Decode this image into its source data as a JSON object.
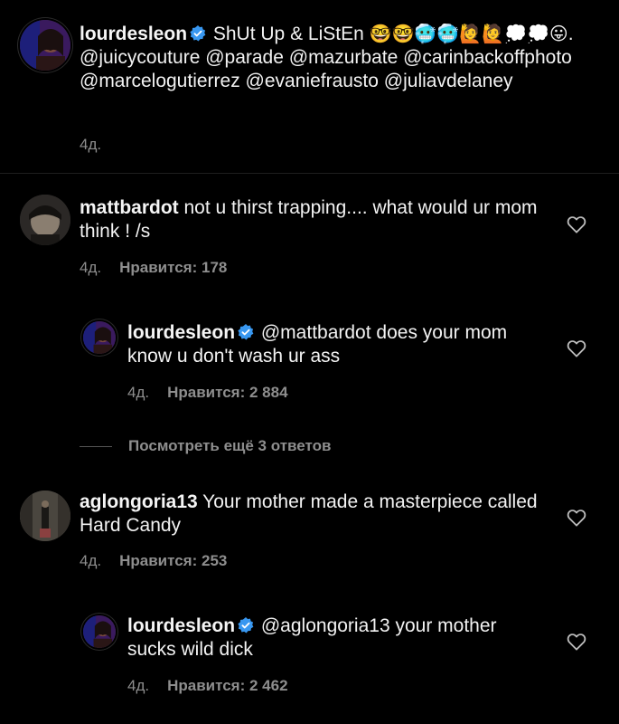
{
  "caption": {
    "username": "lourdesleon",
    "text_before_tags": " ShUt Up & LiStEn ",
    "emojis": "🤓🤓🥶🥶🙋🙋💭💭😛",
    "tags": ". @juicycouture @parade @mazurbate @carinbackoffphoto @marcelogutierrez @evaniefrausto @juliavdelaney",
    "time": "4д."
  },
  "comments": [
    {
      "username": "mattbardot",
      "text": " not u thirst trapping.... what would ur mom think ! /s",
      "time": "4д.",
      "likes": "Нравится: 178",
      "avatar_color": "#5b5650",
      "replies": [
        {
          "username": "lourdesleon",
          "verified": true,
          "text": " @mattbardot does your mom know u don't wash ur ass",
          "time": "4д.",
          "likes": "Нравится: 2 884"
        }
      ],
      "view_more": "Посмотреть ещё 3 ответов"
    },
    {
      "username": "aglongoria13",
      "text": " Your mother made a masterpiece called Hard Candy",
      "time": "4д.",
      "likes": "Нравится: 253",
      "avatar_color": "#6a6358",
      "replies": [
        {
          "username": "lourdesleon",
          "verified": true,
          "text": " @aglongoria13 your mother sucks wild dick",
          "time": "4д.",
          "likes": "Нравится: 2 462"
        }
      ]
    }
  ],
  "colors": {
    "background": "#000000",
    "text": "#f2f2f2",
    "secondary": "#8e8e8e",
    "verified": "#3897f0"
  },
  "icons": {
    "verified": "verified-badge-icon",
    "like": "heart-outline-icon"
  }
}
